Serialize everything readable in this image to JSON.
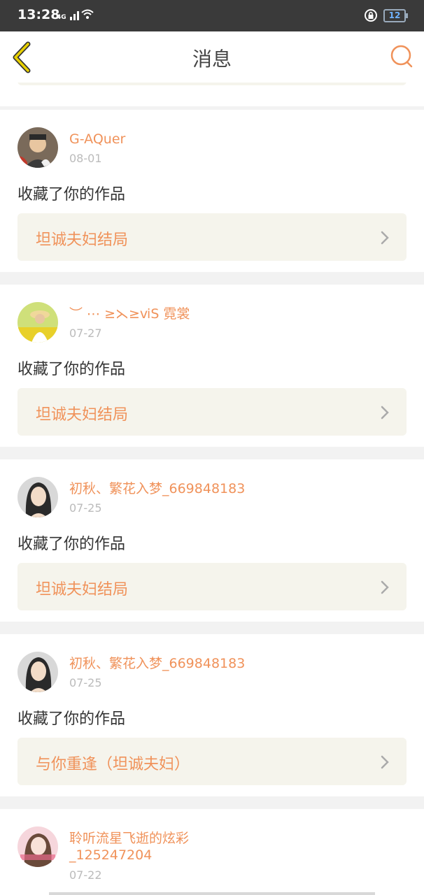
{
  "status_bar": {
    "time": "13:28",
    "network": "4G",
    "battery": "12"
  },
  "nav": {
    "title": "消息"
  },
  "messages": [
    {
      "user": "G-AQuer",
      "date": "08-01",
      "action": "收藏了你的作品",
      "work": "坦诚夫妇结局",
      "avatar": "boy-avatar"
    },
    {
      "user": "︶ ⋯ ≥⋋≥ⅵS 霓裳",
      "date": "07-27",
      "action": "收藏了你的作品",
      "work": "坦诚夫妇结局",
      "avatar": "girl-hat-avatar"
    },
    {
      "user": "初秋、繁花入梦_669848183",
      "date": "07-25",
      "action": "收藏了你的作品",
      "work": "坦诚夫妇结局",
      "avatar": "woman-avatar"
    },
    {
      "user": "初秋、繁花入梦_669848183",
      "date": "07-25",
      "action": "收藏了你的作品",
      "work": "与你重逢（坦诚夫妇）",
      "avatar": "woman-avatar"
    },
    {
      "user": "聆听流星飞逝的炫彩",
      "user_line2": "_125247204",
      "date": "07-22",
      "avatar": "pink-avatar"
    }
  ],
  "colors": {
    "accent": "#f0925a",
    "link_bg": "#f5f4ec",
    "back_arrow": "#c9b100"
  }
}
